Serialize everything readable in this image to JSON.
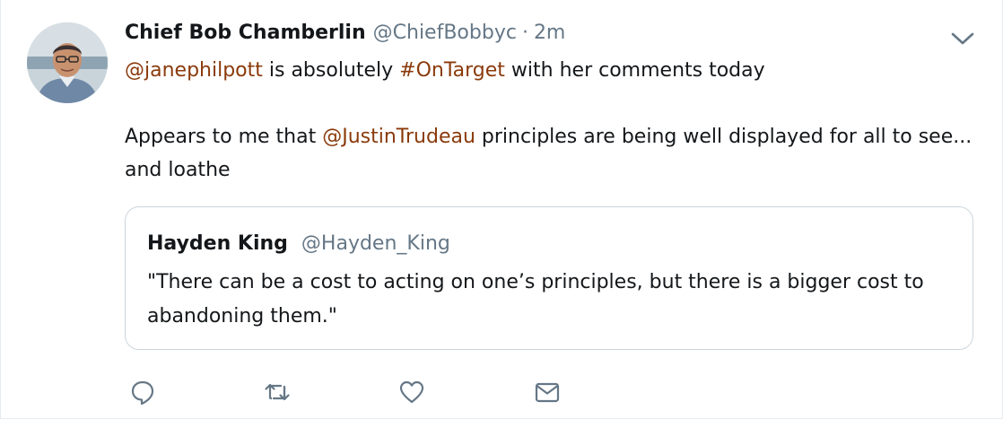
{
  "tweet": {
    "display_name": "Chief Bob Chamberlin",
    "handle": "@ChiefBobbyc",
    "separator": "·",
    "time": "2m",
    "line1": {
      "mention": "@janephilpott",
      "text_a": " is absolutely ",
      "hashtag": "#OnTarget",
      "text_b": " with her comments today"
    },
    "line2": {
      "text_a": "Appears to me that ",
      "mention": "@JustinTrudeau",
      "text_b": " principles are being well displayed for all to see... and loathe"
    }
  },
  "quote": {
    "display_name": "Hayden King",
    "handle": "@Hayden_King",
    "text": "\"There can be a cost to acting on one’s principles, but there is a bigger cost to abandoning them.\""
  },
  "actions": {
    "reply_icon": "speech-bubble",
    "retweet_icon": "retweet-arrows",
    "like_icon": "heart",
    "dm_icon": "envelope"
  },
  "colors": {
    "link": "#8a3a0b",
    "secondary_text": "#657786",
    "border": "#ccd6dd",
    "icon": "#657786"
  }
}
